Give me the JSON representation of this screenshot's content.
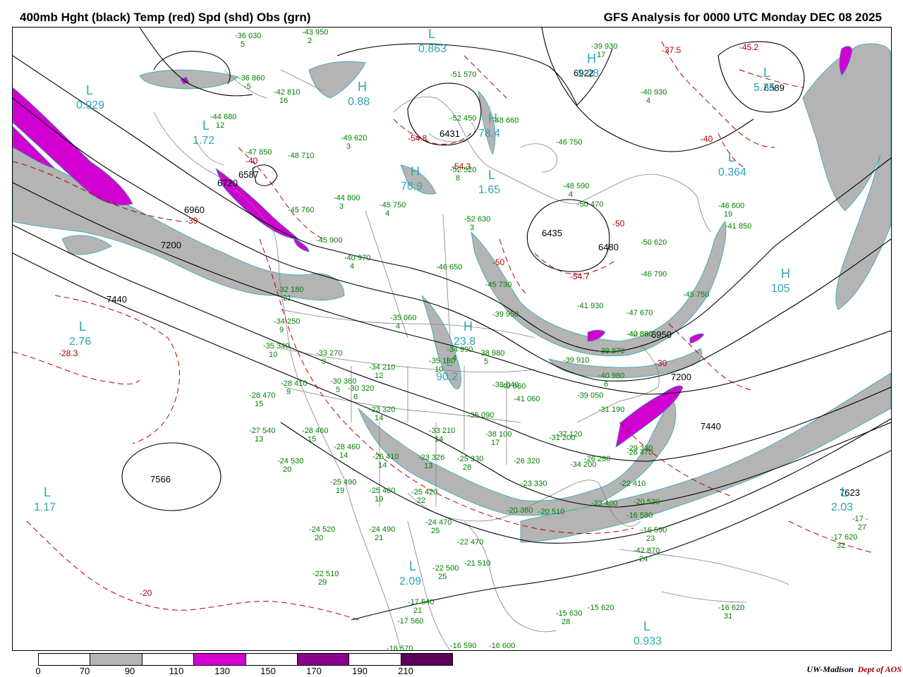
{
  "title_left": "400mb Hght (black) Temp (red) Spd (shd) Obs (grn)",
  "title_right": "GFS Analysis for 0000 UTC Monday  DEC 08 2025",
  "credit": {
    "org": "UW-Madison",
    "dept": "Dept of AOS"
  },
  "legend": {
    "labels": [
      "0",
      "70",
      "90",
      "110",
      "130",
      "150",
      "170",
      "190",
      "210"
    ],
    "colors": [
      "#ffffff",
      "#b4b4b4",
      "#ffffff",
      "#d000d0",
      "#ffffff",
      "#8a008a",
      "#ffffff",
      "#5a005a"
    ]
  },
  "colors": {
    "height": "#000000",
    "temp": "#b00000",
    "jet_gray": "#b4b4b4",
    "jet_magenta": "#d000d0",
    "pressure_center": "#2aa6b4",
    "obs": "#008000",
    "geo": "#808080"
  },
  "height_labels": [
    "7200",
    "7440",
    "6960",
    "6587",
    "6720",
    "6431",
    "6435",
    "6480",
    "6589",
    "7200",
    "7440",
    "7566",
    "7623",
    "6922",
    "6950"
  ],
  "temp_labels": [
    "-40",
    "-39",
    "-28.3",
    "-54.8",
    "-54.7",
    "-50",
    "-50",
    "-37.5",
    "-45.2",
    "-40",
    "-30",
    "-20",
    "-54.3"
  ],
  "centers": [
    {
      "type": "L",
      "value": "0.929"
    },
    {
      "type": "L",
      "value": "1.72"
    },
    {
      "type": "L",
      "value": "2.76"
    },
    {
      "type": "L",
      "value": "1.17"
    },
    {
      "type": "L",
      "value": "0.863"
    },
    {
      "type": "H",
      "value": "0.88"
    },
    {
      "type": "H",
      "value": "78.9"
    },
    {
      "type": "L",
      "value": "1.65"
    },
    {
      "type": "H",
      "value": "78.4"
    },
    {
      "type": "H",
      "value": "23.8"
    },
    {
      "type": "L",
      "value": "90.2"
    },
    {
      "type": "L",
      "value": "2.09"
    },
    {
      "type": "L",
      "value": "0.933"
    },
    {
      "type": "L",
      "value": "0.364"
    },
    {
      "type": "L",
      "value": "5.35"
    },
    {
      "type": "H",
      "value": "105"
    },
    {
      "type": "L",
      "value": "2.03"
    },
    {
      "type": "H",
      "value": "1.28"
    }
  ],
  "obs": [
    {
      "t": "-36",
      "h": "030",
      "d": "5"
    },
    {
      "t": "-43",
      "h": "950",
      "d": "2"
    },
    {
      "t": "-36",
      "h": "860",
      "d": "-5"
    },
    {
      "t": "-42",
      "h": "810",
      "d": "16"
    },
    {
      "t": "-44",
      "h": "680",
      "d": "12"
    },
    {
      "t": "-47",
      "h": "850",
      "d": "-"
    },
    {
      "t": "-48",
      "h": "710",
      "d": "-"
    },
    {
      "t": "-49",
      "h": "620",
      "d": "3"
    },
    {
      "t": "-44",
      "h": "800",
      "d": "3"
    },
    {
      "t": "-45",
      "h": "750",
      "d": "4"
    },
    {
      "t": "-45",
      "h": "760",
      "d": "-"
    },
    {
      "t": "-45",
      "h": "900",
      "d": "-"
    },
    {
      "t": "-40",
      "h": "970",
      "d": "4"
    },
    {
      "t": "-32",
      "h": "180",
      "d": "21"
    },
    {
      "t": "-34",
      "h": "250",
      "d": "9"
    },
    {
      "t": "-35",
      "h": "060",
      "d": "4"
    },
    {
      "t": "-35",
      "h": "340",
      "d": "10"
    },
    {
      "t": "-33",
      "h": "270",
      "d": "3"
    },
    {
      "t": "-34",
      "h": "210",
      "d": "12"
    },
    {
      "t": "-35",
      "h": "180",
      "d": "10"
    },
    {
      "t": "-34",
      "h": "990",
      "d": "4"
    },
    {
      "t": "-38",
      "h": "980",
      "d": "5"
    },
    {
      "t": "-28",
      "h": "410",
      "d": "9"
    },
    {
      "t": "-30",
      "h": "360",
      "d": "5"
    },
    {
      "t": "-30",
      "h": "320",
      "d": "6"
    },
    {
      "t": "-28",
      "h": "470",
      "d": "15"
    },
    {
      "t": "-27",
      "h": "540",
      "d": "13"
    },
    {
      "t": "-28",
      "h": "460",
      "d": "15"
    },
    {
      "t": "-23",
      "h": "320",
      "d": "14"
    },
    {
      "t": "-33",
      "h": "210",
      "d": "14"
    },
    {
      "t": "-28",
      "h": "460",
      "d": "14"
    },
    {
      "t": "-26",
      "h": "410",
      "d": "14"
    },
    {
      "t": "-23",
      "h": "326",
      "d": "13"
    },
    {
      "t": "-25",
      "h": "330",
      "d": "28"
    },
    {
      "t": "-24",
      "h": "530",
      "d": "20"
    },
    {
      "t": "-25",
      "h": "490",
      "d": "19"
    },
    {
      "t": "-25",
      "h": "460",
      "d": "19"
    },
    {
      "t": "-25",
      "h": "420",
      "d": "22"
    },
    {
      "t": "-24",
      "h": "520",
      "d": "20"
    },
    {
      "t": "-24",
      "h": "490",
      "d": "21"
    },
    {
      "t": "-24",
      "h": "470",
      "d": "25"
    },
    {
      "t": "-22",
      "h": "470",
      "d": "-"
    },
    {
      "t": "-22",
      "h": "510",
      "d": "29"
    },
    {
      "t": "-22",
      "h": "500",
      "d": "25"
    },
    {
      "t": "-21",
      "h": "510",
      "d": "-"
    },
    {
      "t": "-17",
      "h": "540",
      "d": "21"
    },
    {
      "t": "-17",
      "h": "560",
      "d": "-"
    },
    {
      "t": "-16",
      "h": "570",
      "d": "-"
    },
    {
      "t": "-16",
      "h": "590",
      "d": "-"
    },
    {
      "t": "-16",
      "h": "600",
      "d": "-"
    },
    {
      "t": "-15",
      "h": "630",
      "d": "28"
    },
    {
      "t": "-15",
      "h": "620",
      "d": "-"
    },
    {
      "t": "-16",
      "h": "620",
      "d": "31"
    },
    {
      "t": "-17",
      "h": "620",
      "d": "32"
    },
    {
      "t": "-17",
      "h": "-",
      "d": "27"
    },
    {
      "t": "-52",
      "h": "450",
      "d": "-"
    },
    {
      "t": "-51",
      "h": "570",
      "d": "-"
    },
    {
      "t": "-52",
      "h": "520",
      "d": "8"
    },
    {
      "t": "-48",
      "h": "660",
      "d": "-"
    },
    {
      "t": "-46",
      "h": "750",
      "d": "-"
    },
    {
      "t": "-48",
      "h": "590",
      "d": "4"
    },
    {
      "t": "-50",
      "h": "470",
      "d": "-"
    },
    {
      "t": "-52",
      "h": "630",
      "d": "3"
    },
    {
      "t": "-46",
      "h": "650",
      "d": "-"
    },
    {
      "t": "-45",
      "h": "730",
      "d": "-"
    },
    {
      "t": "-50",
      "h": "620",
      "d": "-"
    },
    {
      "t": "-46",
      "h": "600",
      "d": "19"
    },
    {
      "t": "-41",
      "h": "850",
      "d": "-"
    },
    {
      "t": "-46",
      "h": "790",
      "d": "-"
    },
    {
      "t": "-45",
      "h": "750",
      "d": "-"
    },
    {
      "t": "-41",
      "h": "930",
      "d": "-"
    },
    {
      "t": "-47",
      "h": "670",
      "d": "-"
    },
    {
      "t": "-42",
      "h": "880",
      "d": "-"
    },
    {
      "t": "-39",
      "h": "950",
      "d": "-"
    },
    {
      "t": "-40",
      "h": "890",
      "d": "-"
    },
    {
      "t": "-39",
      "h": "870",
      "d": "-"
    },
    {
      "t": "-39",
      "h": "910",
      "d": "-"
    },
    {
      "t": "-40",
      "h": "980",
      "d": "6"
    },
    {
      "t": "-38",
      "h": "040",
      "d": "-"
    },
    {
      "t": "-40",
      "h": "060",
      "d": "-"
    },
    {
      "t": "-41",
      "h": "060",
      "d": "-"
    },
    {
      "t": "-39",
      "h": "050",
      "d": "-"
    },
    {
      "t": "-35",
      "h": "090",
      "d": "-"
    },
    {
      "t": "-38",
      "h": "100",
      "d": "17"
    },
    {
      "t": "-37",
      "h": "120",
      "d": "-"
    },
    {
      "t": "-31",
      "h": "190",
      "d": "-"
    },
    {
      "t": "-29",
      "h": "320",
      "d": "-"
    },
    {
      "t": "-31",
      "h": "200",
      "d": "-"
    },
    {
      "t": "-34",
      "h": "200",
      "d": "-"
    },
    {
      "t": "-26",
      "h": "320",
      "d": "-"
    },
    {
      "t": "-26",
      "h": "280",
      "d": "-"
    },
    {
      "t": "-23",
      "h": "330",
      "d": "-"
    },
    {
      "t": "-20",
      "h": "380",
      "d": "-"
    },
    {
      "t": "-26",
      "h": "470",
      "d": "-"
    },
    {
      "t": "-22",
      "h": "410",
      "d": "-"
    },
    {
      "t": "-23",
      "h": "400",
      "d": "-"
    },
    {
      "t": "-20",
      "h": "510",
      "d": "-"
    },
    {
      "t": "-20",
      "h": "520",
      "d": "-"
    },
    {
      "t": "-16",
      "h": "580",
      "d": "-"
    },
    {
      "t": "-16",
      "h": "590",
      "d": "23"
    },
    {
      "t": "-42",
      "h": "870",
      "d": "24"
    },
    {
      "t": "-39",
      "h": "930",
      "d": "17"
    },
    {
      "t": "-40",
      "h": "930",
      "d": "4"
    }
  ]
}
